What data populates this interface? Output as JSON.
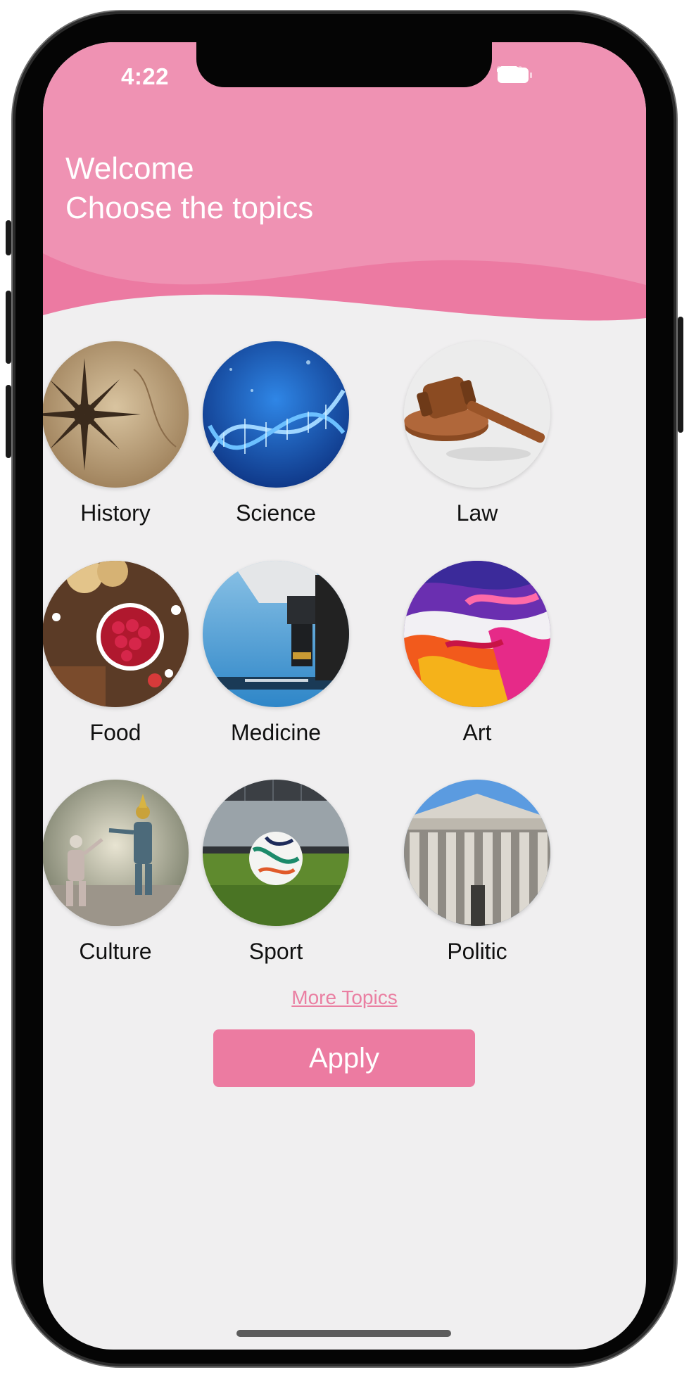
{
  "status_bar": {
    "time": "4:22"
  },
  "header": {
    "greeting": "Welcome",
    "subtitle": "Choose the topics",
    "colors": {
      "top": "#ef92b3",
      "wave": "#ec7aa2"
    }
  },
  "topics": [
    {
      "label": "History",
      "icon": "compass-map-image"
    },
    {
      "label": "Science",
      "icon": "dna-image"
    },
    {
      "label": "Law",
      "icon": "gavel-image"
    },
    {
      "label": "Food",
      "icon": "raspberries-image"
    },
    {
      "label": "Medicine",
      "icon": "microscope-image"
    },
    {
      "label": "Art",
      "icon": "paint-strokes-image"
    },
    {
      "label": "Culture",
      "icon": "dancers-image"
    },
    {
      "label": "Sport",
      "icon": "soccer-ball-image"
    },
    {
      "label": "Politic",
      "icon": "courthouse-image"
    }
  ],
  "more_topics_label": "More Topics",
  "apply_label": "Apply",
  "accent_color": "#ec7ba1"
}
